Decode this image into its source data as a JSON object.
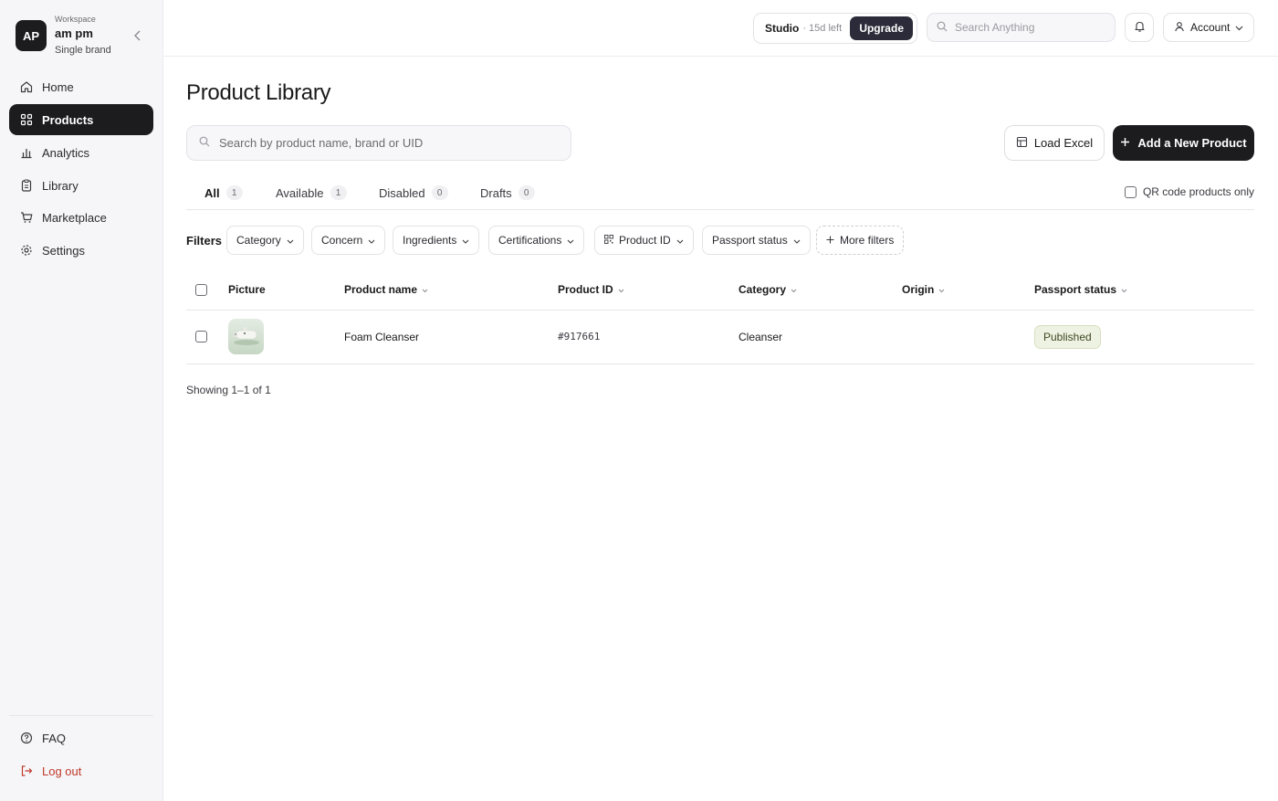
{
  "workspace": {
    "initials": "AP",
    "label": "Workspace",
    "name": "am pm",
    "subtitle": "Single brand"
  },
  "sidebar": {
    "items": [
      {
        "label": "Home",
        "icon": "home-icon",
        "active": false
      },
      {
        "label": "Products",
        "icon": "grid-icon",
        "active": true
      },
      {
        "label": "Analytics",
        "icon": "bar-chart-icon",
        "active": false
      },
      {
        "label": "Library",
        "icon": "clipboard-icon",
        "active": false
      },
      {
        "label": "Marketplace",
        "icon": "cart-icon",
        "active": false
      },
      {
        "label": "Settings",
        "icon": "gear-icon",
        "active": false
      }
    ],
    "footer": [
      {
        "label": "FAQ",
        "icon": "help-circle-icon"
      },
      {
        "label": "Log out",
        "icon": "logout-icon"
      }
    ]
  },
  "topbar": {
    "plan_name": "Studio",
    "plan_time": "· 15d left",
    "upgrade_label": "Upgrade",
    "search_placeholder": "Search Anything",
    "account_label": "Account"
  },
  "main": {
    "title": "Product Library",
    "search_placeholder": "Search by product name, brand or UID",
    "load_excel_label": "Load Excel",
    "add_product_label": "Add a New Product",
    "tabs": [
      {
        "label": "All",
        "count": "1",
        "active": true
      },
      {
        "label": "Available",
        "count": "1",
        "active": false
      },
      {
        "label": "Disabled",
        "count": "0",
        "active": false
      },
      {
        "label": "Drafts",
        "count": "0",
        "active": false
      }
    ],
    "qr_only_label": "QR code products only",
    "filters_label": "Filters",
    "filters": [
      "Category",
      "Concern",
      "Ingredients",
      "Certifications",
      "Product ID",
      "Passport status"
    ],
    "more_filters_label": "More filters",
    "columns": [
      "Picture",
      "Product name",
      "Product ID",
      "Category",
      "Origin",
      "Passport status"
    ],
    "rows": [
      {
        "name": "Foam Cleanser",
        "product_id": "#917661",
        "category": "Cleanser",
        "origin": "",
        "status": "Published"
      }
    ],
    "showing": "Showing 1–1 of 1"
  },
  "colors": {
    "accent_dark": "#1c1c1f",
    "upgrade_bg": "#2b2b3a",
    "logout": "#c0392b",
    "published_bg": "#eef2e2"
  }
}
